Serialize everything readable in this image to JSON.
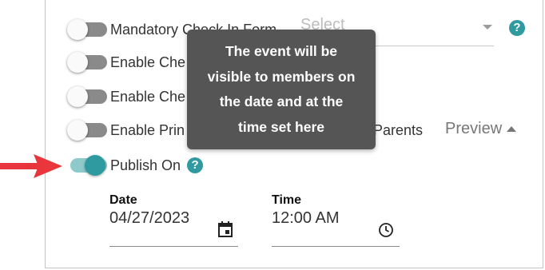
{
  "form": {
    "rows": [
      {
        "label": "Mandatory Check In Form",
        "on": false
      },
      {
        "label": "Enable Che",
        "on": false
      },
      {
        "label": "Enable Che",
        "on": false
      },
      {
        "label": "Enable Prin",
        "label_tail": "d Parents",
        "on": false
      },
      {
        "label": "Publish On",
        "on": true
      }
    ],
    "select": {
      "placeholder": "Select"
    },
    "preview": {
      "label": "Preview"
    },
    "tooltip": {
      "lines": [
        "The event will be",
        "visible to members on",
        "the date and at the",
        "time set here"
      ]
    },
    "date": {
      "label": "Date",
      "value": "04/27/2023"
    },
    "time": {
      "label": "Time",
      "value": "12:00 AM"
    },
    "help_icon": "question-circle-icon",
    "colors": {
      "accent": "#2f9aa0",
      "arrow": "#e8363c",
      "tooltip_bg": "#555555"
    }
  }
}
